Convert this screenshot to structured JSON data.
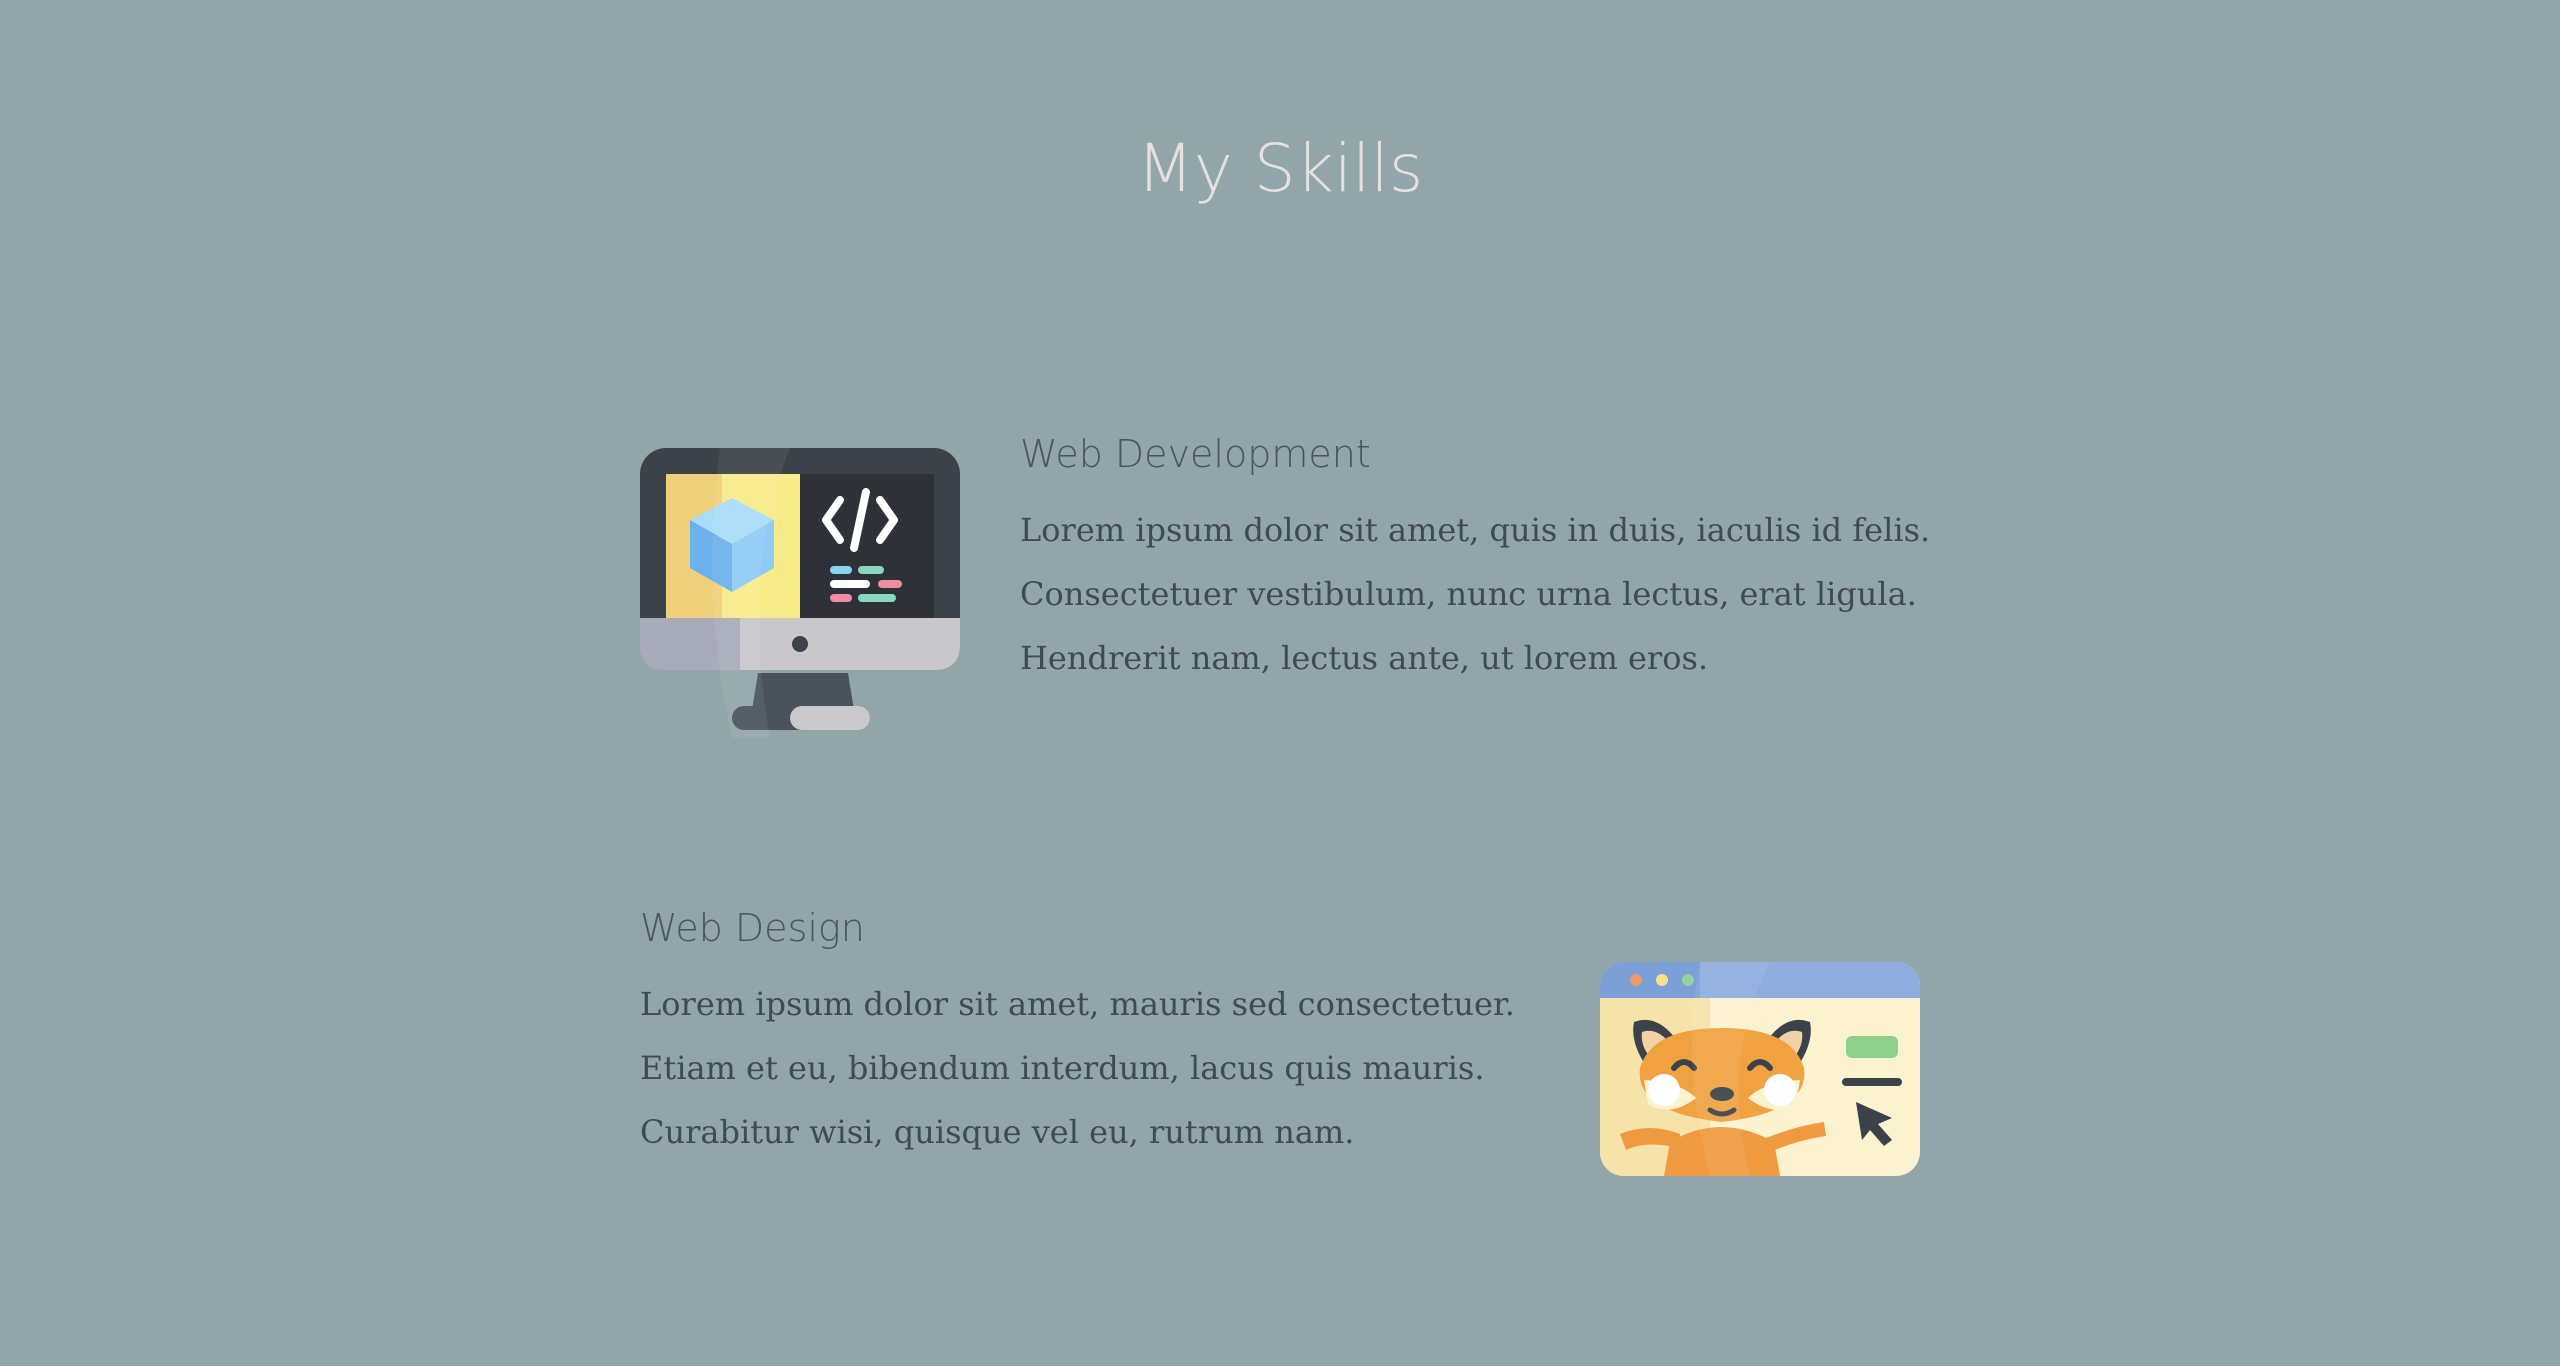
{
  "page": {
    "title": "My Skills",
    "background_color": "#92a5a8"
  },
  "skills": [
    {
      "heading": "Web Development",
      "icon": "monitor-code-icon",
      "lines": [
        "Lorem ipsum dolor sit amet, quis in duis, iaculis id felis.",
        "Consectetuer vestibulum, nunc urna lectus, erat ligula.",
        "Hendrerit nam, lectus ante, ut lorem eros."
      ]
    },
    {
      "heading": "Web Design",
      "icon": "browser-fox-icon",
      "lines": [
        "Lorem ipsum dolor sit amet, mauris sed consectetuer.",
        "Etiam et eu, bibendum interdum, lacus quis mauris.",
        "Curabitur wisi, quisque vel eu, rutrum nam."
      ]
    }
  ]
}
